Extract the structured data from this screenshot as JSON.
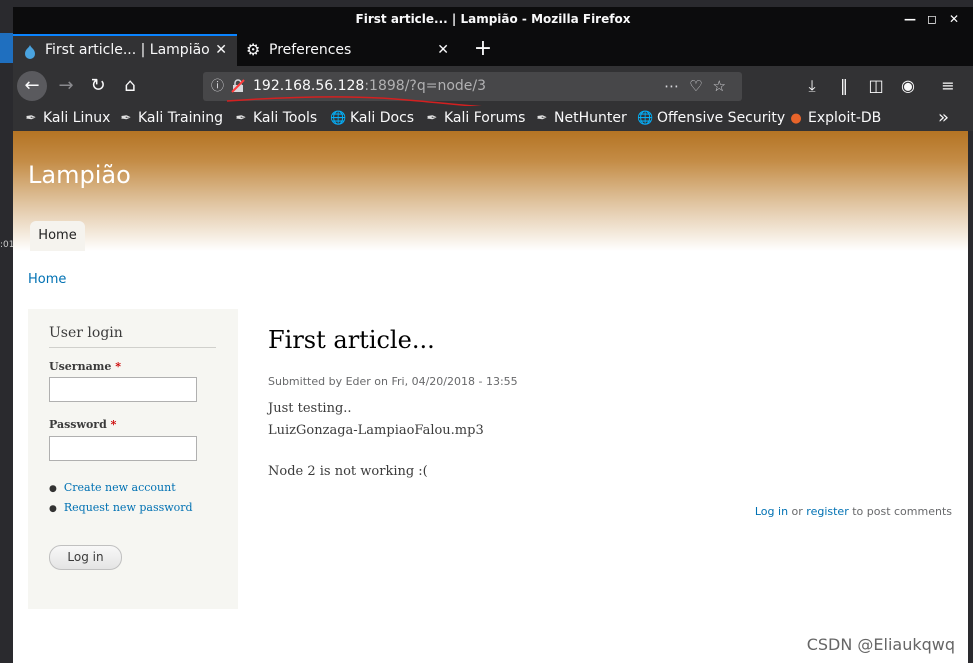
{
  "window": {
    "title": "First article... | Lampião - Mozilla Firefox"
  },
  "tabs": [
    {
      "label": "First article... | Lampião",
      "active": true
    },
    {
      "label": "Preferences",
      "active": false
    }
  ],
  "navbar": {
    "url_host": "192.168.56.128",
    "url_rest": ":1898/?q=node/3"
  },
  "bookmarks": [
    {
      "label": "Kali Linux",
      "icon": "kali-icon"
    },
    {
      "label": "Kali Training",
      "icon": "kali-icon"
    },
    {
      "label": "Kali Tools",
      "icon": "kali-icon"
    },
    {
      "label": "Kali Docs",
      "icon": "globe-icon"
    },
    {
      "label": "Kali Forums",
      "icon": "kali-icon"
    },
    {
      "label": "NetHunter",
      "icon": "kali-icon"
    },
    {
      "label": "Offensive Security",
      "icon": "globe-icon"
    },
    {
      "label": "Exploit-DB",
      "icon": "exploit-db-icon"
    }
  ],
  "site": {
    "name": "Lampião",
    "nav_home": "Home",
    "breadcrumb": "Home"
  },
  "login_block": {
    "title": "User login",
    "username_label": "Username",
    "password_label": "Password",
    "required_mark": "*",
    "links": [
      "Create new account",
      "Request new password"
    ],
    "button": "Log in"
  },
  "article": {
    "title": "First article...",
    "submitted": "Submitted by Eder on Fri, 04/20/2018 - 13:55",
    "lines": [
      "Just testing..",
      "LuizGonzaga-LampiaoFalou.mp3",
      "Node 2 is not working :("
    ],
    "comment_login": "Log in",
    "comment_or": " or ",
    "comment_register": "register",
    "comment_suffix": " to post comments"
  },
  "watermark": "CSDN @Eliaukqwq",
  "colors": {
    "accent": "#0a84ff",
    "link": "#0071b3",
    "header_top": "#b47424"
  }
}
